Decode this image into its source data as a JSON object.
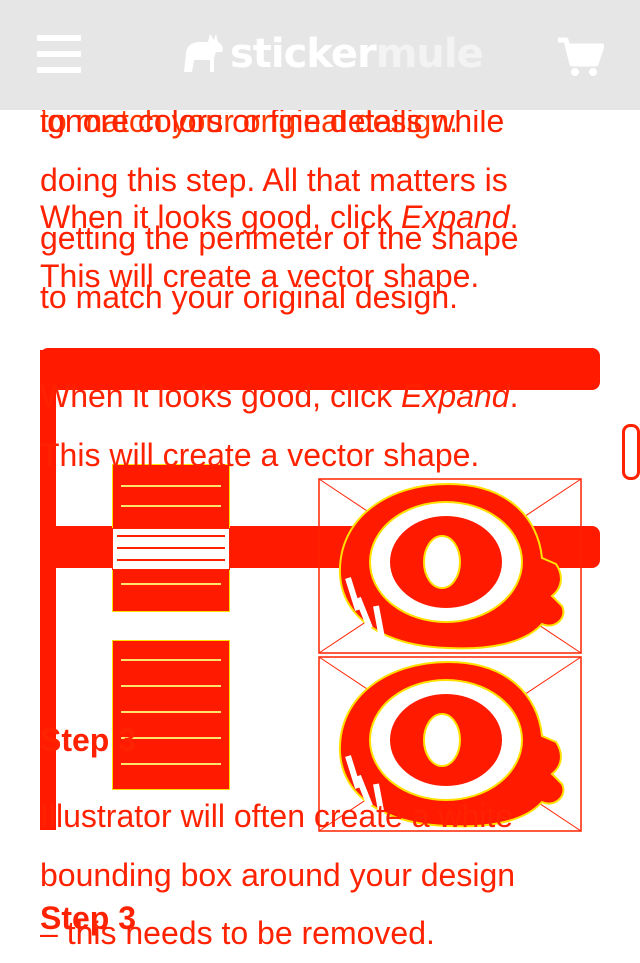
{
  "header": {
    "logo_word1": "sticker",
    "logo_word2": "mule",
    "background": "#e6e6e6",
    "icons": [
      "hamburger-menu-icon",
      "mule-logo-icon",
      "shopping-cart-icon"
    ]
  },
  "content": {
    "ghost_line": "to match your original design.",
    "para_a": [
      "ignore colors or fine details while",
      "doing this step. All that matters is",
      "getting the perimeter of the shape",
      "to match your original design."
    ],
    "overlay_a_1_pre": "When it looks good, click ",
    "overlay_a_1_em": "Expand",
    "overlay_a_1_post": ".",
    "overlay_a_2": "This will create a vector shape.",
    "para_b_1_pre": "When it looks good, click ",
    "para_b_1_em": "Expand",
    "para_b_1_post": ".",
    "para_b_2": "This will create a vector shape.",
    "step_label": "Step 3",
    "step_label_2": "Step 3",
    "para_c": [
      "Illustrator will often create a white",
      "bounding box around your design",
      "– this needs to be removed."
    ]
  },
  "colors": {
    "text": "#ff2200",
    "band": "#ff1a00",
    "highlight": "#ffe000"
  }
}
